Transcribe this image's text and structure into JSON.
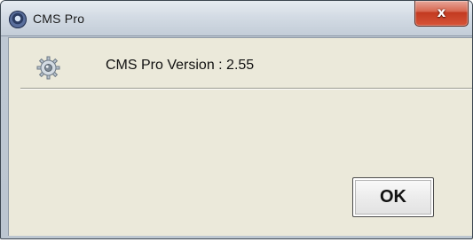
{
  "window": {
    "title": "CMS Pro",
    "close_symbol": "x"
  },
  "icons": {
    "title_icon": "app-gear-icon",
    "content_icon": "gear-icon"
  },
  "content": {
    "version_text": "CMS Pro Version : 2.55"
  },
  "buttons": {
    "ok_label": "OK"
  },
  "colors": {
    "client_background": "#ebe9da",
    "close_button_red": "#c23a20",
    "title_text": "#1b1b1b"
  }
}
